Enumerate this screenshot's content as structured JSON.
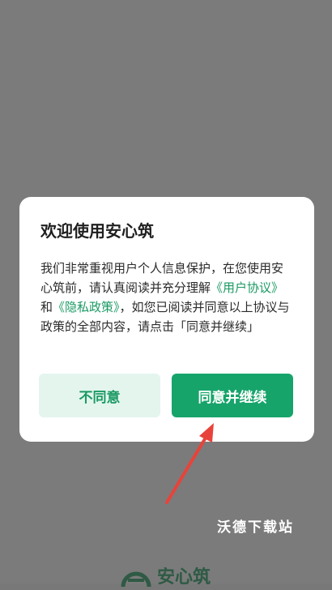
{
  "dialog": {
    "title": "欢迎使用安心筑",
    "body_prefix": "我们非常重视用户个人信息保护，在您使用安心筑前，请认真阅读并充分理解",
    "link_user_agreement": "《用户协议》",
    "body_and": "和",
    "link_privacy_policy": "《隐私政策》",
    "body_suffix": "，如您已阅读并同意以上协议与政策的全部内容，请点击「同意并继续」",
    "disagree_label": "不同意",
    "agree_label": "同意并继续"
  },
  "watermark": {
    "text": "沃德下载站"
  },
  "bottom_logo": {
    "text": "安心筑"
  },
  "colors": {
    "accent": "#17a46b",
    "link": "#1a9a63",
    "disagree_bg": "#e4f5ee",
    "overlay": "#7b7b7b",
    "arrow": "#e8433a"
  }
}
